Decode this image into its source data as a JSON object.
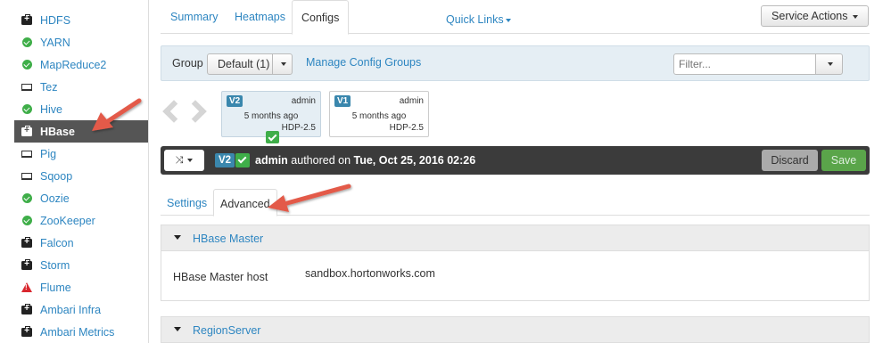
{
  "sidebar": {
    "services": [
      {
        "label": "HDFS",
        "icon": "medkit-icon",
        "status": "maintenance"
      },
      {
        "label": "YARN",
        "icon": "check-circle-icon",
        "status": "ok"
      },
      {
        "label": "MapReduce2",
        "icon": "check-circle-icon",
        "status": "ok"
      },
      {
        "label": "Tez",
        "icon": "laptop-icon",
        "status": "client"
      },
      {
        "label": "Hive",
        "icon": "check-circle-icon",
        "status": "ok"
      },
      {
        "label": "HBase",
        "icon": "medkit-icon",
        "status": "maintenance",
        "active": true
      },
      {
        "label": "Pig",
        "icon": "laptop-icon",
        "status": "client"
      },
      {
        "label": "Sqoop",
        "icon": "laptop-icon",
        "status": "client"
      },
      {
        "label": "Oozie",
        "icon": "check-circle-icon",
        "status": "ok"
      },
      {
        "label": "ZooKeeper",
        "icon": "check-circle-icon",
        "status": "ok"
      },
      {
        "label": "Falcon",
        "icon": "medkit-icon",
        "status": "maintenance"
      },
      {
        "label": "Storm",
        "icon": "medkit-icon",
        "status": "maintenance"
      },
      {
        "label": "Flume",
        "icon": "warning-icon",
        "status": "alert"
      },
      {
        "label": "Ambari Infra",
        "icon": "medkit-icon",
        "status": "maintenance"
      },
      {
        "label": "Ambari Metrics",
        "icon": "medkit-icon",
        "status": "maintenance"
      }
    ]
  },
  "topnav": {
    "tabs": [
      "Summary",
      "Heatmaps",
      "Configs"
    ],
    "active_tab": "Configs",
    "quick_links": "Quick Links",
    "service_actions": "Service Actions"
  },
  "group_bar": {
    "label": "Group",
    "selected": "Default (1)",
    "manage": "Manage Config Groups",
    "filter_placeholder": "Filter..."
  },
  "versions": [
    {
      "badge": "V2",
      "user": "admin",
      "time": "5 months ago",
      "stack": "HDP-2.5",
      "current": true
    },
    {
      "badge": "V1",
      "user": "admin",
      "time": "5 months ago",
      "stack": "HDP-2.5",
      "current": false
    }
  ],
  "version_bar": {
    "badge": "V2",
    "user": "admin",
    "authored": "authored on",
    "date": "Tue, Oct 25, 2016 02:26",
    "discard": "Discard",
    "save": "Save"
  },
  "subtabs": {
    "items": [
      "Settings",
      "Advanced"
    ],
    "active": "Advanced"
  },
  "panels": [
    {
      "title": "HBase Master",
      "rows": [
        {
          "key": "HBase Master host",
          "value": "sandbox.hortonworks.com"
        }
      ]
    },
    {
      "title": "RegionServer",
      "rows": []
    }
  ],
  "colors": {
    "link": "#2e86c1",
    "ok": "#3fae49",
    "alert": "#d9272e",
    "badge": "#3a87ad",
    "annotation_arrow": "#e35a4a"
  }
}
